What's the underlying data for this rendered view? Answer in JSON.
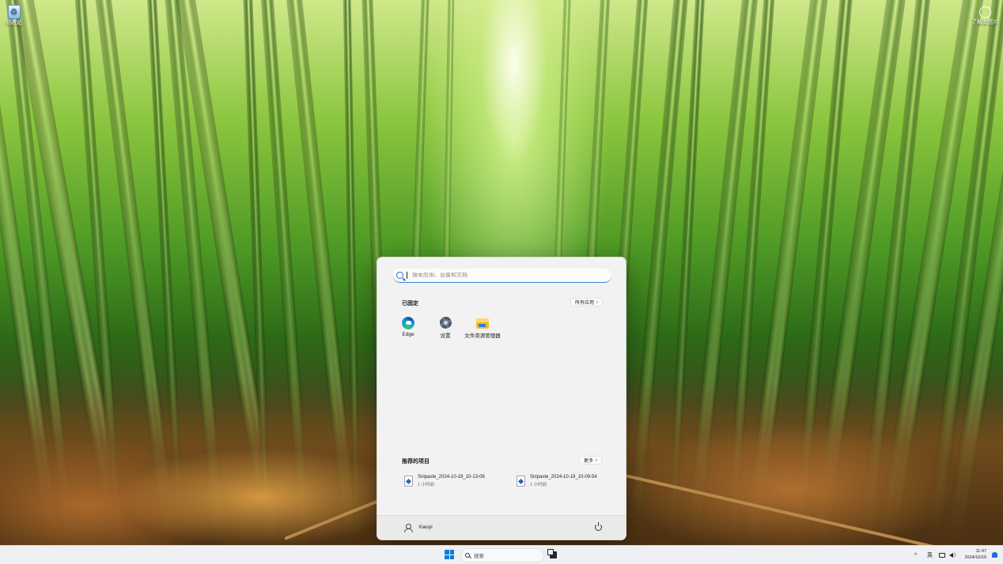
{
  "desktop": {
    "recycle_bin_label": "回收站",
    "top_right_label": "了解此图片",
    "top_right_icon": "user-circle-icon"
  },
  "start_menu": {
    "search": {
      "placeholder": "搜索应用、设置和文档",
      "value": ""
    },
    "pinned": {
      "title": "已固定",
      "all_apps_label": "所有应用",
      "apps": [
        {
          "label": "Edge",
          "icon": "edge-icon"
        },
        {
          "label": "设置",
          "icon": "settings-gear-icon"
        },
        {
          "label": "文件资源管理器",
          "icon": "file-explorer-icon"
        }
      ]
    },
    "recommended": {
      "title": "推荐的项目",
      "more_label": "更多",
      "items": [
        {
          "name": "Snipaste_2024-10-19_10-13-08",
          "time": "1 小时前"
        },
        {
          "name": "Snipaste_2024-10-19_10-09-54",
          "time": "1 小时前"
        }
      ]
    },
    "user": {
      "name": "Xiaoyi"
    }
  },
  "taskbar": {
    "search_label": "搜索",
    "tray": {
      "chevron": "^",
      "ime": "英",
      "time": "11:47",
      "date": "2024/10/19"
    }
  },
  "colors": {
    "accent": "#0f7ad8",
    "menu_bg": "#f2f2f2",
    "taskbar_bg": "#eef0f3"
  }
}
